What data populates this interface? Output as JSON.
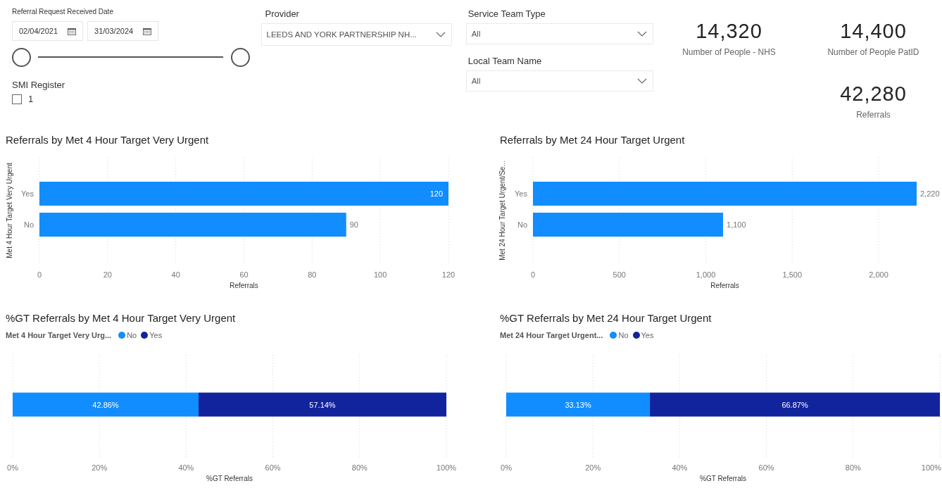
{
  "date_slicer": {
    "title": "Referral Request Received Date",
    "start_date": "02/04/2021",
    "end_date": "31/03/2024"
  },
  "smi_register": {
    "title": "SMI Register",
    "options": [
      {
        "label": "1",
        "checked": false
      }
    ]
  },
  "provider": {
    "title": "Provider",
    "value": "LEEDS AND YORK PARTNERSHIP NH..."
  },
  "service_team_type": {
    "title": "Service Team Type",
    "value": "All"
  },
  "local_team_name": {
    "title": "Local Team Name",
    "value": "All"
  },
  "cards": [
    {
      "value": "14,320",
      "label": "Number of People - NHS"
    },
    {
      "value": "14,400",
      "label": "Number of People PatID"
    },
    {
      "value": "42,280",
      "label": "Referrals"
    }
  ],
  "charts": [
    {
      "chart_data": {
        "type": "bar",
        "orientation": "horizontal",
        "title": "Referrals by Met 4 Hour Target Very Urgent",
        "xlabel": "Referrals",
        "ylabel": "Met 4 Hour Target Very Urgent",
        "categories": [
          "Yes",
          "No"
        ],
        "series": [
          {
            "color": "#118dff",
            "values": [
              120,
              90
            ],
            "value_labels": [
              "120",
              "90"
            ]
          }
        ],
        "xlim": [
          0,
          120
        ],
        "xticks": [
          0,
          20,
          40,
          60,
          80,
          100,
          120
        ],
        "grid": true,
        "data_labels": true
      }
    },
    {
      "chart_data": {
        "type": "bar",
        "orientation": "horizontal",
        "title": "Referrals by Met 24 Hour Target Urgent",
        "xlabel": "Referrals",
        "ylabel": "Met 24 Hour Target Urgent/Se...",
        "categories": [
          "Yes",
          "No"
        ],
        "series": [
          {
            "color": "#118dff",
            "values": [
              2220,
              1100
            ],
            "value_labels": [
              "2,220",
              "1,100"
            ]
          }
        ],
        "xlim": [
          0,
          2220
        ],
        "xticks": [
          0,
          500,
          {
            "value": 1000,
            "label": "1,000"
          },
          {
            "value": 1500,
            "label": "1,500"
          },
          {
            "value": 2000,
            "label": "2,000"
          }
        ],
        "grid": true,
        "data_labels": true
      }
    },
    {
      "legend_title": "Met 4 Hour Target Very Urg...",
      "chart_data": {
        "type": "bar",
        "orientation": "horizontal",
        "stacked": true,
        "title": "%GT Referrals by Met 4 Hour Target Very Urgent",
        "xlabel": "%GT Referrals",
        "series": [
          {
            "name": "No",
            "color": "#118dff",
            "values": [
              42.86
            ],
            "value_labels": [
              "42.86%"
            ]
          },
          {
            "name": "Yes",
            "color": "#12239e",
            "values": [
              57.14
            ],
            "value_labels": [
              "57.14%"
            ]
          }
        ],
        "xlim": [
          0,
          100
        ],
        "xticks": [
          {
            "value": 0,
            "label": "0%"
          },
          {
            "value": 20,
            "label": "20%"
          },
          {
            "value": 40,
            "label": "40%"
          },
          {
            "value": 60,
            "label": "60%"
          },
          {
            "value": 80,
            "label": "80%"
          },
          {
            "value": 100,
            "label": "100%"
          }
        ],
        "grid": true,
        "data_labels": true
      }
    },
    {
      "legend_title": "Met 24 Hour Target Urgent...",
      "chart_data": {
        "type": "bar",
        "orientation": "horizontal",
        "stacked": true,
        "title": "%GT Referrals by Met 24 Hour Target Urgent",
        "xlabel": "%GT Referrals",
        "series": [
          {
            "name": "No",
            "color": "#118dff",
            "values": [
              33.13
            ],
            "value_labels": [
              "33.13%"
            ]
          },
          {
            "name": "Yes",
            "color": "#12239e",
            "values": [
              66.87
            ],
            "value_labels": [
              "66.87%"
            ]
          }
        ],
        "xlim": [
          0,
          100
        ],
        "xticks": [
          {
            "value": 0,
            "label": "0%"
          },
          {
            "value": 20,
            "label": "20%"
          },
          {
            "value": 40,
            "label": "40%"
          },
          {
            "value": 60,
            "label": "60%"
          },
          {
            "value": 80,
            "label": "80%"
          },
          {
            "value": 100,
            "label": "100%"
          }
        ],
        "grid": true,
        "data_labels": true
      }
    }
  ]
}
